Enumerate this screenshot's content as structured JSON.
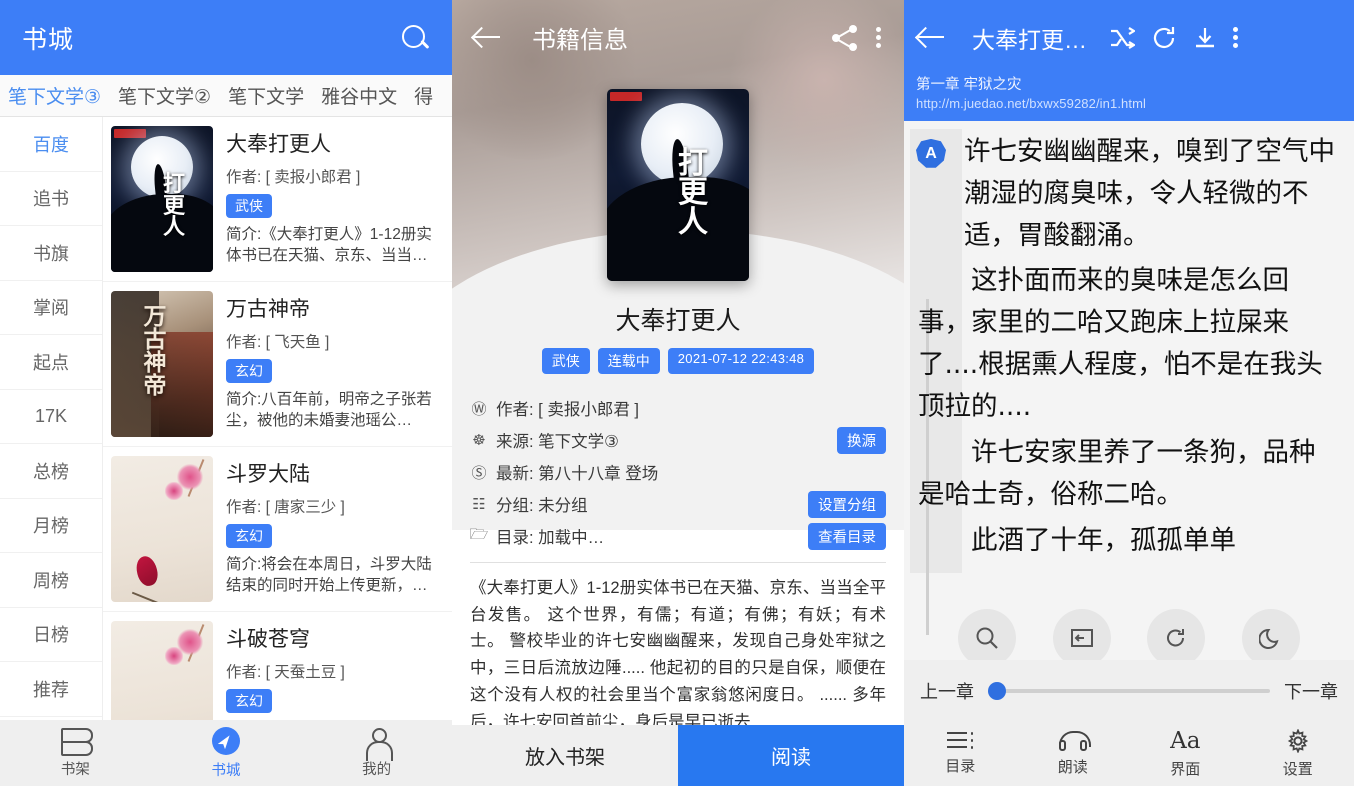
{
  "panel1": {
    "header": {
      "title": "书城",
      "search_icon": "search-icon"
    },
    "tabs": [
      {
        "label": "笔下文学③",
        "active": true
      },
      {
        "label": "笔下文学②",
        "active": false
      },
      {
        "label": "笔下文学",
        "active": false
      },
      {
        "label": "雅谷中文",
        "active": false
      },
      {
        "label": "得",
        "active": false
      }
    ],
    "sidebar": [
      {
        "label": "百度",
        "active": true
      },
      {
        "label": "追书",
        "active": false
      },
      {
        "label": "书旗",
        "active": false
      },
      {
        "label": "掌阅",
        "active": false
      },
      {
        "label": "起点",
        "active": false
      },
      {
        "label": "17K",
        "active": false
      },
      {
        "label": "总榜",
        "active": false
      },
      {
        "label": "月榜",
        "active": false
      },
      {
        "label": "周榜",
        "active": false
      },
      {
        "label": "日榜",
        "active": false
      },
      {
        "label": "推荐",
        "active": false
      }
    ],
    "books": [
      {
        "title": "大奉打更人",
        "author": "作者: [ 卖报小郎君 ]",
        "tag": "武侠",
        "desc": "简介:《大奉打更人》1-12册实体书已在天猫、京东、当当…"
      },
      {
        "title": "万古神帝",
        "author": "作者: [ 飞天鱼 ]",
        "tag": "玄幻",
        "desc": "简介:八百年前，明帝之子张若尘，被他的未婚妻池瑶公…"
      },
      {
        "title": "斗罗大陆",
        "author": "作者: [ 唐家三少 ]",
        "tag": "玄幻",
        "desc": "简介:将会在本周日，斗罗大陆结束的同时开始上传更新，…"
      },
      {
        "title": "斗破苍穹",
        "author": "作者: [ 天蚕土豆 ]",
        "tag": "玄幻",
        "desc": ""
      }
    ],
    "bottom_nav": [
      {
        "label": "书架",
        "icon": "bookshelf-icon",
        "active": false
      },
      {
        "label": "书城",
        "icon": "compass-icon",
        "active": true
      },
      {
        "label": "我的",
        "icon": "person-icon",
        "active": false
      }
    ]
  },
  "panel2": {
    "header": {
      "title": "书籍信息",
      "back_icon": "back-arrow-icon",
      "share_icon": "share-icon",
      "more_icon": "more-vertical-icon"
    },
    "book_name": "大奉打更人",
    "badges": [
      "武侠",
      "连载中",
      "2021-07-12 22:43:48"
    ],
    "meta": [
      {
        "icon": "author-icon",
        "label": "作者: [ 卖报小郎君 ]",
        "action": ""
      },
      {
        "icon": "globe-icon",
        "label": "来源: 笔下文学③",
        "action": "换源"
      },
      {
        "icon": "latest-icon",
        "label": "最新: 第八十八章 登场",
        "action": ""
      },
      {
        "icon": "group-icon",
        "label": "分组: 未分组",
        "action": "设置分组"
      },
      {
        "icon": "folder-icon",
        "label": "目录: 加载中…",
        "action": "查看目录"
      }
    ],
    "description": "《大奉打更人》1-12册实体书已在天猫、京东、当当全平台发售。 这个世界，有儒；有道；有佛；有妖；有术士。 警校毕业的许七安幽幽醒来，发现自己身处牢狱之中，三日后流放边陲..... 他起初的目的只是自保，顺便在这个没有人权的社会里当个富家翁悠闲度日。 ...... 多年后，许七安回首前尘，身后是早已逝去",
    "actions": {
      "secondary": "放入书架",
      "primary": "阅读"
    }
  },
  "panel3": {
    "header": {
      "title": "大奉打更…",
      "back_icon": "back-arrow-icon",
      "shuffle_icon": "shuffle-icon",
      "refresh_icon": "refresh-icon",
      "download_icon": "download-icon",
      "more_icon": "more-vertical-icon"
    },
    "chapter": "第一章 牢狱之灾",
    "url": "http://m.juedao.net/bxwx59282/in1.html",
    "source_mark": "A",
    "paragraphs": [
      "许七安幽幽醒来，嗅到了空气中潮湿的腐臭味，令人轻微的不适，胃酸翻涌。",
      "这扑面而来的臭味是怎么回事，家里的二哈又跑床上拉屎来了....根据熏人程度，怕不是在我头顶拉的....",
      "许七安家里养了一条狗，品种是哈士奇，俗称二哈。",
      "此酒了十年，孤孤单单"
    ],
    "floating_buttons": [
      {
        "icon": "search-icon"
      },
      {
        "icon": "screen-flip-icon"
      },
      {
        "icon": "auto-read-icon"
      },
      {
        "icon": "night-mode-icon"
      }
    ],
    "seek": {
      "prev_label": "上一章",
      "next_label": "下一章",
      "progress": 2
    },
    "tools": [
      {
        "label": "目录",
        "icon": "toc-icon"
      },
      {
        "label": "朗读",
        "icon": "headphone-icon"
      },
      {
        "label": "界面",
        "icon": "font-size-icon"
      },
      {
        "label": "设置",
        "icon": "gear-icon"
      }
    ]
  },
  "colors": {
    "accent": "#3d7ef7",
    "primary_button": "#2878f0",
    "tag": "#3d7ef7"
  }
}
